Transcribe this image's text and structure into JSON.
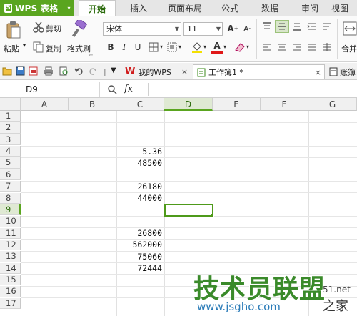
{
  "app": {
    "title": "WPS 表格",
    "logo_glyph": "S",
    "caret": "▾"
  },
  "menu_tabs": [
    "开始",
    "插入",
    "页面布局",
    "公式",
    "数据",
    "审阅",
    "视图"
  ],
  "ribbon": {
    "paste_label": "粘贴",
    "cut_label": "剪切",
    "copy_label": "复制",
    "format_painter_label": "格式刷",
    "font_name": "宋体",
    "font_size": "11",
    "bold": "B",
    "italic": "I",
    "underline": "U",
    "grow_font": "A",
    "shrink_font": "A",
    "font_color_glyph": "A",
    "merge_label": "合并"
  },
  "doc_tabs": [
    {
      "label": "我的WPS",
      "close": "×"
    },
    {
      "label": "工作簿1 *",
      "close": "×"
    },
    {
      "label": "账簿"
    }
  ],
  "formula_bar": {
    "cell_ref": "D9",
    "fx_label": "fx",
    "formula": ""
  },
  "columns": [
    "A",
    "B",
    "C",
    "D",
    "E",
    "F",
    "G"
  ],
  "selected_column": "D",
  "rows": [
    "1",
    "2",
    "3",
    "4",
    "5",
    "6",
    "7",
    "8",
    "9",
    "10",
    "11",
    "12",
    "13",
    "14",
    "15",
    "16",
    "17"
  ],
  "selected_row": "9",
  "cells": {
    "C4": "5.36",
    "C5": "48500",
    "C7": "26180",
    "C8": "44000",
    "C11": "26800",
    "C12": "562000",
    "C13": "75060",
    "C14": "72444"
  },
  "watermark": {
    "main": "技术员联盟",
    "url": "www.jsgho.com",
    "suffix": "之家",
    "small": "51.net"
  },
  "colors": {
    "accent": "#5aa51f",
    "selection": "#4e9a1a"
  }
}
